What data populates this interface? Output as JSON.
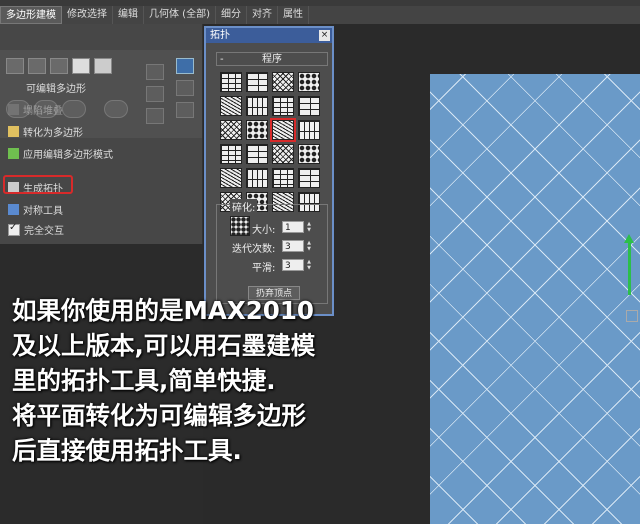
{
  "menu": {
    "tabs": [
      {
        "label": "多边形建模",
        "active": true
      },
      {
        "label": "修改选择",
        "active": false
      },
      {
        "label": "编辑",
        "active": false
      },
      {
        "label": "几何体 (全部)",
        "active": false
      },
      {
        "label": "细分",
        "active": false
      },
      {
        "label": "对齐",
        "active": false
      },
      {
        "label": "属性",
        "active": false
      }
    ]
  },
  "panel": {
    "editable_poly_label": "可编辑多边形",
    "commands": {
      "collapse_stack": "塌陷堆叠",
      "convert_to_poly": "转化为多边形",
      "apply_edit_poly": "应用编辑多边形模式",
      "generate_topology": "生成拓扑",
      "symmetry_tools": "对称工具",
      "full_interactivity": "完全交互"
    }
  },
  "topology_dialog": {
    "title": "拓扑",
    "close_glyph": "×",
    "procedural_label": "程序",
    "collapse_glyph": "-",
    "pattern_count": 24,
    "selected_pattern_index": 10,
    "fragmentation_label": "碎化:",
    "size_label": "大小:",
    "size_value": "1",
    "iterations_label": "迭代次数:",
    "iterations_value": "3",
    "smooth_label": "平滑:",
    "smooth_value": "3",
    "discard_vertices_label": "扔弃顶点"
  },
  "caption": {
    "lines": [
      "如果你使用的是MAX2010",
      "及以上版本,可以用石墨建模",
      "里的拓扑工具,简单快捷.",
      "将平面转化为可编辑多边形",
      "后直接使用拓扑工具."
    ]
  },
  "colors": {
    "highlight_red": "#d82a2a",
    "plane_blue": "#6a9ac8",
    "dialog_title_blue": "#3c5d9a",
    "gizmo_green": "#2cbf4a"
  }
}
